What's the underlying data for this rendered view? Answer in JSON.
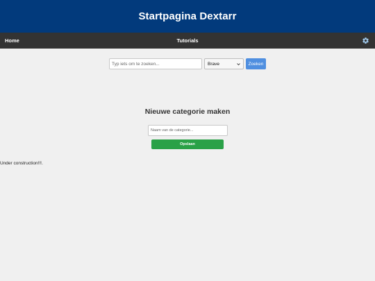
{
  "header": {
    "title": "Startpagina Dextarr"
  },
  "nav": {
    "home_label": "Home",
    "tutorials_label": "Tutorials",
    "settings_icon": "gear-icon"
  },
  "search": {
    "placeholder": "Typ iets om te zoeken...",
    "value": "",
    "engine_selected": "Brave",
    "button_label": "Zoeken"
  },
  "category": {
    "title": "Nieuwe categorie maken",
    "input_placeholder": "Naam van de categorie...",
    "input_value": "",
    "save_label": "Opslaan"
  },
  "status": {
    "construction_text": "Under construction!!!."
  },
  "colors": {
    "header_bg": "#023a7c",
    "nav_bg": "#333333",
    "search_button": "#4f8fe0",
    "save_button": "#2aa147",
    "page_bg": "#f0f0f0"
  }
}
